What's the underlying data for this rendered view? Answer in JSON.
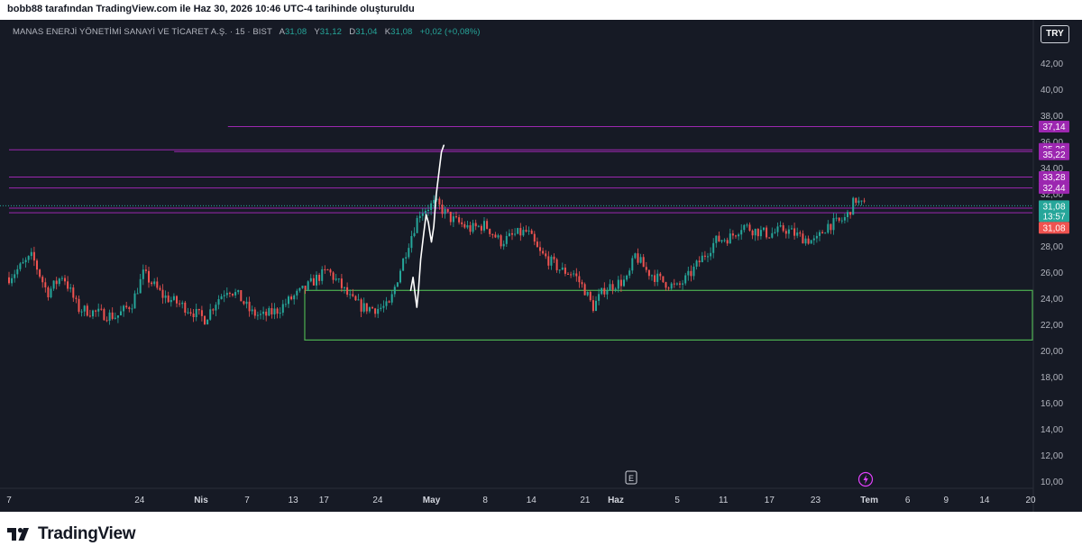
{
  "header": {
    "title": "bobb88 tarafından TradingView.com ile Haz 30, 2026 10:46 UTC-4 tarihinde oluşturuldu"
  },
  "symbol": {
    "name": "MANAS ENERJİ YÖNETİMİ SANAYİ VE TİCARET A.Ş. · 15 · BIST",
    "open_label": "A",
    "open": "31,08",
    "high_label": "Y",
    "high": "31,12",
    "low_label": "D",
    "low": "31,04",
    "close_label": "K",
    "close": "31,08",
    "change": "+0,02 (+0,08%)"
  },
  "currency_button": "TRY",
  "footer": {
    "brand": "TradingView"
  },
  "markers": {
    "earnings": "E"
  },
  "colors": {
    "background": "#161a25",
    "up": "#26a69a",
    "down": "#ef5350",
    "level_line": "#9c27b0",
    "level_label": "#9c27b0",
    "zone": "#4caf50",
    "sketch": "#ffffff"
  },
  "chart_data": {
    "type": "candlestick",
    "ylim": [
      9.5,
      43.5
    ],
    "y_ticks": [
      {
        "value": 42,
        "label": "42,00"
      },
      {
        "value": 40,
        "label": "40,00"
      },
      {
        "value": 38,
        "label": "38,00"
      },
      {
        "value": 36,
        "label": "36,00"
      },
      {
        "value": 34,
        "label": "34,00"
      },
      {
        "value": 32,
        "label": "32,00"
      },
      {
        "value": 30,
        "label": "30,00"
      },
      {
        "value": 28,
        "label": "28,00"
      },
      {
        "value": 26,
        "label": "26,00"
      },
      {
        "value": 24,
        "label": "24,00"
      },
      {
        "value": 22,
        "label": "22,00"
      },
      {
        "value": 20,
        "label": "20,00"
      },
      {
        "value": 18,
        "label": "18,00"
      },
      {
        "value": 16,
        "label": "16,00"
      },
      {
        "value": 14,
        "label": "14,00"
      },
      {
        "value": 12,
        "label": "12,00"
      },
      {
        "value": 10,
        "label": "10,00"
      }
    ],
    "x_ticks": [
      {
        "label": "7",
        "t": 0
      },
      {
        "label": "24",
        "t": 17
      },
      {
        "label": "Nis",
        "t": 25,
        "bold": true
      },
      {
        "label": "7",
        "t": 31
      },
      {
        "label": "13",
        "t": 37
      },
      {
        "label": "17",
        "t": 41
      },
      {
        "label": "24",
        "t": 48
      },
      {
        "label": "May",
        "t": 55,
        "bold": true
      },
      {
        "label": "8",
        "t": 62
      },
      {
        "label": "14",
        "t": 68
      },
      {
        "label": "21",
        "t": 75
      },
      {
        "label": "Haz",
        "t": 79,
        "bold": true
      },
      {
        "label": "5",
        "t": 87
      },
      {
        "label": "11",
        "t": 93
      },
      {
        "label": "17",
        "t": 99
      },
      {
        "label": "23",
        "t": 105
      },
      {
        "label": "Tem",
        "t": 112,
        "bold": true
      },
      {
        "label": "6",
        "t": 117
      },
      {
        "label": "9",
        "t": 122
      },
      {
        "label": "14",
        "t": 127
      },
      {
        "label": "20",
        "t": 133
      }
    ],
    "price_path": [
      [
        0,
        25.6
      ],
      [
        3,
        27.2
      ],
      [
        5,
        24.4
      ],
      [
        7,
        25.8
      ],
      [
        9,
        23.2
      ],
      [
        12,
        22.8
      ],
      [
        14,
        22.6
      ],
      [
        16,
        23.6
      ],
      [
        17.5,
        25.9
      ],
      [
        20,
        24.2
      ],
      [
        23,
        23.3
      ],
      [
        25.5,
        22.4
      ],
      [
        27,
        23.8
      ],
      [
        28.5,
        24.8
      ],
      [
        30,
        24.1
      ],
      [
        31.5,
        22.9
      ],
      [
        33,
        22.6
      ],
      [
        35,
        23.1
      ],
      [
        36.8,
        24.0
      ],
      [
        38.5,
        24.7
      ],
      [
        40,
        25.5
      ],
      [
        41.5,
        26.1
      ],
      [
        43,
        25.1
      ],
      [
        44.5,
        23.9
      ],
      [
        46,
        23.3
      ],
      [
        48,
        23.2
      ],
      [
        49.5,
        23.4
      ],
      [
        50.5,
        25.4
      ],
      [
        52,
        28.2
      ],
      [
        53.5,
        30.6
      ],
      [
        55.5,
        31.3
      ],
      [
        57.5,
        30.1
      ],
      [
        60,
        29.3
      ],
      [
        62,
        29.6
      ],
      [
        64,
        28.3
      ],
      [
        66,
        28.9
      ],
      [
        67.5,
        29.1
      ],
      [
        69,
        27.5
      ],
      [
        70.5,
        26.8
      ],
      [
        72,
        26.1
      ],
      [
        73.5,
        25.9
      ],
      [
        75,
        24.6
      ],
      [
        76,
        23.3
      ],
      [
        77.5,
        24.7
      ],
      [
        79,
        25.1
      ],
      [
        80.5,
        25.4
      ],
      [
        81.5,
        27.3
      ],
      [
        83,
        26.1
      ],
      [
        85,
        25.3
      ],
      [
        87,
        24.8
      ],
      [
        88.5,
        25.7
      ],
      [
        90,
        26.9
      ],
      [
        92,
        28.4
      ],
      [
        94,
        28.7
      ],
      [
        95.5,
        29.6
      ],
      [
        97,
        29.2
      ],
      [
        99,
        28.9
      ],
      [
        101,
        29.3
      ],
      [
        103,
        28.7
      ],
      [
        105,
        28.3
      ],
      [
        106.5,
        29.6
      ],
      [
        108,
        29.8
      ],
      [
        109,
        30.2
      ],
      [
        110.2,
        31.6
      ],
      [
        110.8,
        31.2
      ],
      [
        111.4,
        31.08
      ]
    ],
    "levels": [
      {
        "value": 37.14,
        "label": "37,14",
        "t_start": 28.5
      },
      {
        "value": 35.36,
        "label": "35,36",
        "t_start": 0
      },
      {
        "value": 35.22,
        "label": "35,22",
        "t_start": 21.5
      },
      {
        "value": 33.28,
        "label": "33,28",
        "t_start": 0
      },
      {
        "value": 32.44,
        "label": "32,44",
        "t_start": 0
      },
      {
        "value": 30.9,
        "label": "30,90",
        "t_start": 0
      },
      {
        "value": 30.54,
        "label": "30,54",
        "t_start": 0
      }
    ],
    "current_price": {
      "value": 31.08,
      "label": "31,08",
      "countdown": "13:57"
    },
    "prev_close": {
      "value": 31.08,
      "label": "31,08"
    },
    "zone": {
      "top": 24.6,
      "bottom": 20.8,
      "t_start": 38.5
    },
    "sketch_path": [
      [
        52.3,
        24.6
      ],
      [
        52.6,
        25.6
      ],
      [
        52.9,
        24.2
      ],
      [
        53.1,
        23.3
      ],
      [
        53.3,
        24.6
      ],
      [
        53.6,
        27.0
      ],
      [
        54.0,
        29.0
      ],
      [
        54.3,
        30.4
      ],
      [
        54.6,
        29.8
      ],
      [
        54.8,
        29.0
      ],
      [
        55.0,
        28.3
      ],
      [
        55.3,
        29.5
      ],
      [
        55.6,
        31.8
      ],
      [
        56.0,
        33.8
      ],
      [
        56.3,
        35.2
      ],
      [
        56.6,
        35.7
      ]
    ],
    "earnings_t": 81,
    "dividend_t": 154
  }
}
